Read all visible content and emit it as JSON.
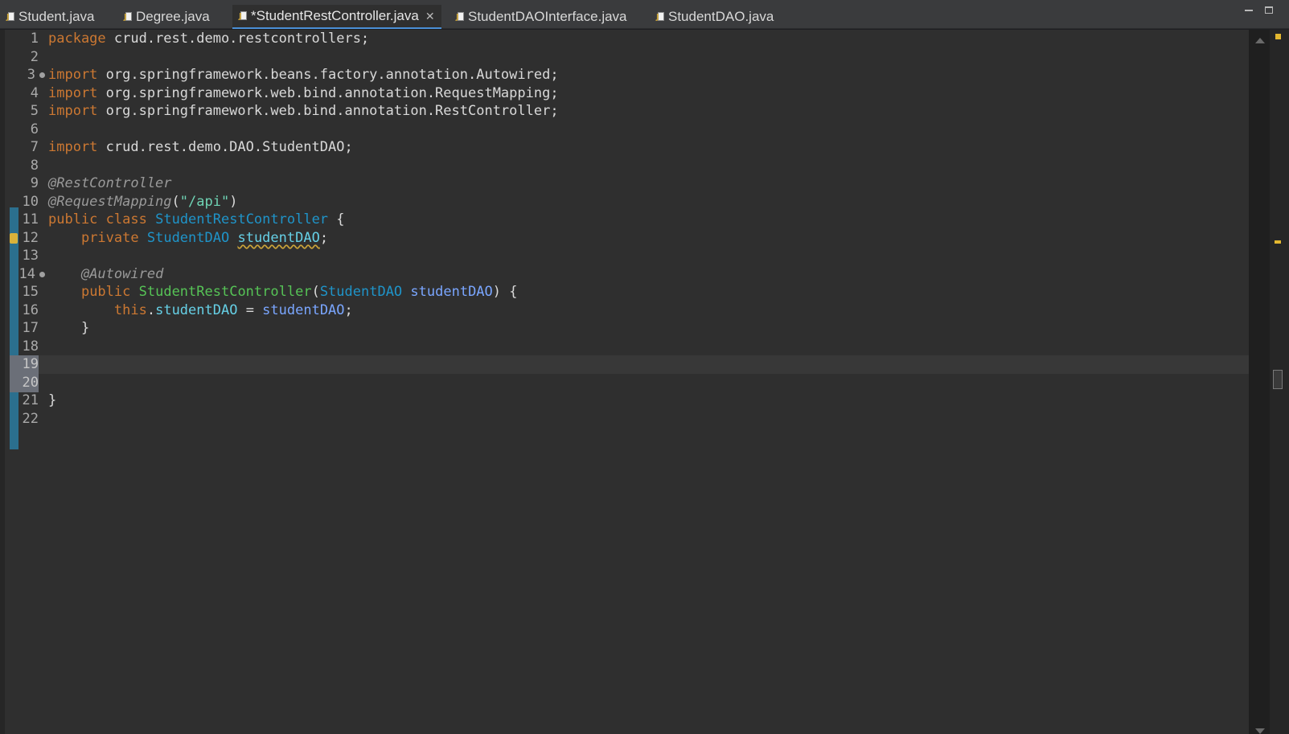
{
  "tabs": [
    {
      "label": "Student.java",
      "active": false
    },
    {
      "label": "Degree.java",
      "active": false
    },
    {
      "label": "*StudentRestController.java",
      "active": true,
      "close": "✕"
    },
    {
      "label": "StudentDAOInterface.java",
      "active": false
    },
    {
      "label": "StudentDAO.java",
      "active": false
    }
  ],
  "editor": {
    "line_numbers": [
      "1",
      "2",
      "3",
      "4",
      "5",
      "6",
      "7",
      "8",
      "9",
      "10",
      "11",
      "12",
      "13",
      "14",
      "15",
      "16",
      "17",
      "18",
      "19",
      "20",
      "21",
      "22"
    ],
    "code": {
      "l1": {
        "kw": "package",
        "rest": " crud.rest.demo.restcontrollers;"
      },
      "l3": {
        "kw": "import",
        "rest": " org.springframework.beans.factory.annotation.Autowired;"
      },
      "l4": {
        "kw": "import",
        "rest": " org.springframework.web.bind.annotation.RequestMapping;"
      },
      "l5": {
        "kw": "import",
        "rest": " org.springframework.web.bind.annotation.RestController;"
      },
      "l7": {
        "kw": "import",
        "rest": " crud.rest.demo.DAO.StudentDAO;"
      },
      "l9": {
        "ann": "@RestController"
      },
      "l10": {
        "ann": "@RequestMapping",
        "p1": "(",
        "str": "\"/api\"",
        "p2": ")"
      },
      "l11": {
        "kw1": "public",
        "kw2": "class",
        "type": "StudentRestController",
        "brace": " {"
      },
      "l12": {
        "indent": "    ",
        "kw": "private",
        "type": "StudentDAO",
        "field": "studentDAO",
        "semi": ";"
      },
      "l14": {
        "indent": "    ",
        "ann": "@Autowired"
      },
      "l15": {
        "indent": "    ",
        "kw": "public",
        "ctor": "StudentRestController",
        "p1": "(",
        "type": "StudentDAO",
        "param": "studentDAO",
        "p2": ") {"
      },
      "l16": {
        "indent": "        ",
        "kw": "this",
        "dot": ".",
        "field": "studentDAO",
        "eq": " = ",
        "param": "studentDAO",
        "semi": ";"
      },
      "l17": {
        "indent": "    ",
        "text": "}"
      },
      "l21": {
        "text": "}"
      }
    }
  },
  "colors": {
    "background": "#2f2f2f",
    "keyword": "#cc7832",
    "annotation": "#9a9a9a",
    "string": "#6fd3b4",
    "type": "#1f94c9",
    "constructor": "#56c356",
    "field": "#66d0e6",
    "parameter": "#7aa6ff",
    "active_tab_underline": "#4a8fd6",
    "change_bar": "#2b6f8e",
    "warning": "#e3b830"
  },
  "icons": {
    "tab_file": "java-file-icon",
    "fold": "fold-marker-icon",
    "warning": "warning-lightbulb-icon"
  }
}
